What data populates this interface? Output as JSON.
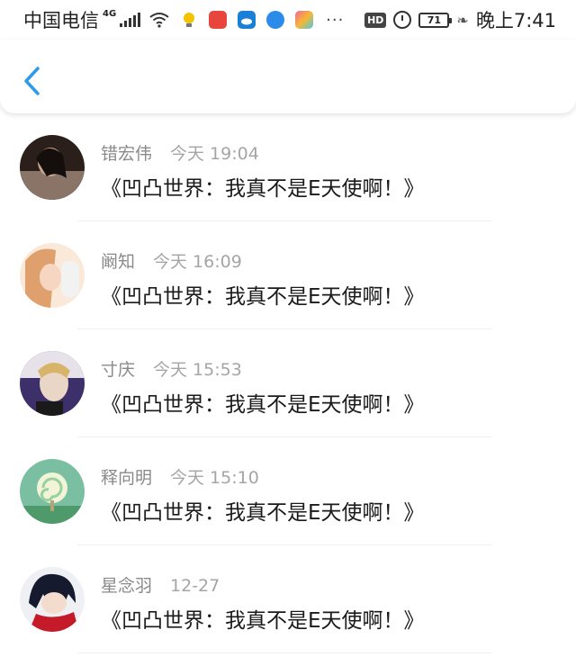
{
  "status_bar": {
    "carrier": "中国电信",
    "network": "4G",
    "hd": "HD",
    "battery": "71",
    "time": "晚上7:41",
    "app_icons": [
      {
        "name": "lightbulb-app-icon",
        "color": "#f4c300"
      },
      {
        "name": "huawei-store-icon",
        "color": "#e8453c"
      },
      {
        "name": "weather-icon",
        "color": "#1a7fd6"
      },
      {
        "name": "globe-app-icon",
        "color": "#2b8be8"
      },
      {
        "name": "colorful-app-icon",
        "color": "#f06a9a"
      }
    ]
  },
  "header": {
    "back_icon": "chevron-left-icon",
    "accent_color": "#2d9be9"
  },
  "messages": [
    {
      "name": "错宏伟",
      "time": "今天 19:04",
      "text": "《凹凸世界：我真不是E天使啊！》",
      "avatar_colors": [
        "#3a2a24",
        "#c9a48a"
      ]
    },
    {
      "name": "阚知",
      "time": "今天 16:09",
      "text": "《凹凸世界：我真不是E天使啊！》",
      "avatar_colors": [
        "#f0c8a6",
        "#fae9d8"
      ]
    },
    {
      "name": "寸庆",
      "time": "今天 15:53",
      "text": "《凹凸世界：我真不是E天使啊！》",
      "avatar_colors": [
        "#3c2f6a",
        "#e9d6c6"
      ]
    },
    {
      "name": "释向明",
      "time": "今天 15:10",
      "text": "《凹凸世界：我真不是E天使啊！》",
      "avatar_colors": [
        "#6fb59a",
        "#e9f0cc"
      ]
    },
    {
      "name": "星念羽",
      "time": "12-27",
      "text": "《凹凸世界：我真不是E天使啊！》",
      "avatar_colors": [
        "#151a2e",
        "#c41a2a"
      ]
    }
  ]
}
